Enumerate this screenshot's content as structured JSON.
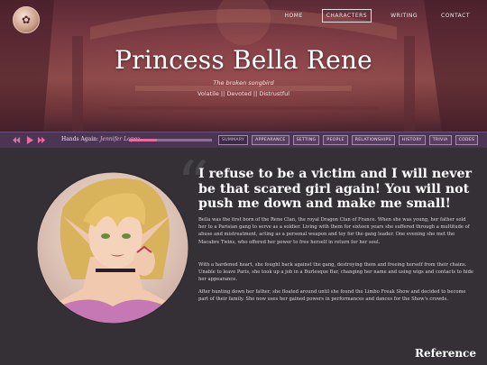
{
  "site": {
    "logo_icon": "rose-emblem-icon",
    "logo_glyph": "✿"
  },
  "nav": [
    {
      "label": "HOME",
      "active": false
    },
    {
      "label": "CHARACTERS",
      "active": true
    },
    {
      "label": "WRITING",
      "active": false
    },
    {
      "label": "CONTACT",
      "active": false
    }
  ],
  "hero": {
    "title": "Princess Bella Rene",
    "subtitle": "The broken songbird",
    "traits": "Volatile || Devoted || Distrustful"
  },
  "player": {
    "song_title": "Hands Again:",
    "artist": "Jennifer Lopez",
    "progress": 0.34,
    "controls": [
      "previous-icon",
      "play-icon",
      "next-icon"
    ]
  },
  "tabs": [
    {
      "label": "SUMMARY",
      "active": true
    },
    {
      "label": "APPEARANCE",
      "active": false
    },
    {
      "label": "SETTING",
      "active": false
    },
    {
      "label": "PEOPLE",
      "active": false
    },
    {
      "label": "RELATIONSHIPS",
      "active": false
    },
    {
      "label": "HISTORY",
      "active": false
    },
    {
      "label": "TRIVIA",
      "active": false
    },
    {
      "label": "CODES",
      "active": false
    }
  ],
  "content": {
    "quote": "I refuse to be a victim and I will never be that scared girl again! You will not push me down and make me small!",
    "paragraphs": [
      "Bella was the first born of the Rene Clan, the royal Dragon Clan of France. When she was young, her father sold her to a Parisian gang to serve as a soldier. Living with them for sixteen years she suffered through a multitude of abuse and mistreatment, acting as a personal weapon and toy for the gang leader. One evening she met the Macabre Twins, who offered her power to free herself in return for her soul.",
      "With a hardened heart, she fought back against the gang, destroying them and freeing herself from their chains. Unable to leave Paris, she took up a job in a Burlesque Bar, changing her name and using wigs and contacts to hide her appearance.",
      "After hunting down her father, she floated around until she found the Limbo Freak Show and decided to become part of their family. She now uses her gained powers in performances and dances for the Show's crowds."
    ]
  },
  "footer": {
    "reference_label": "Reference"
  },
  "colors": {
    "accent": "#e86aa3",
    "bar": "#4a3652",
    "background": "#343036"
  }
}
